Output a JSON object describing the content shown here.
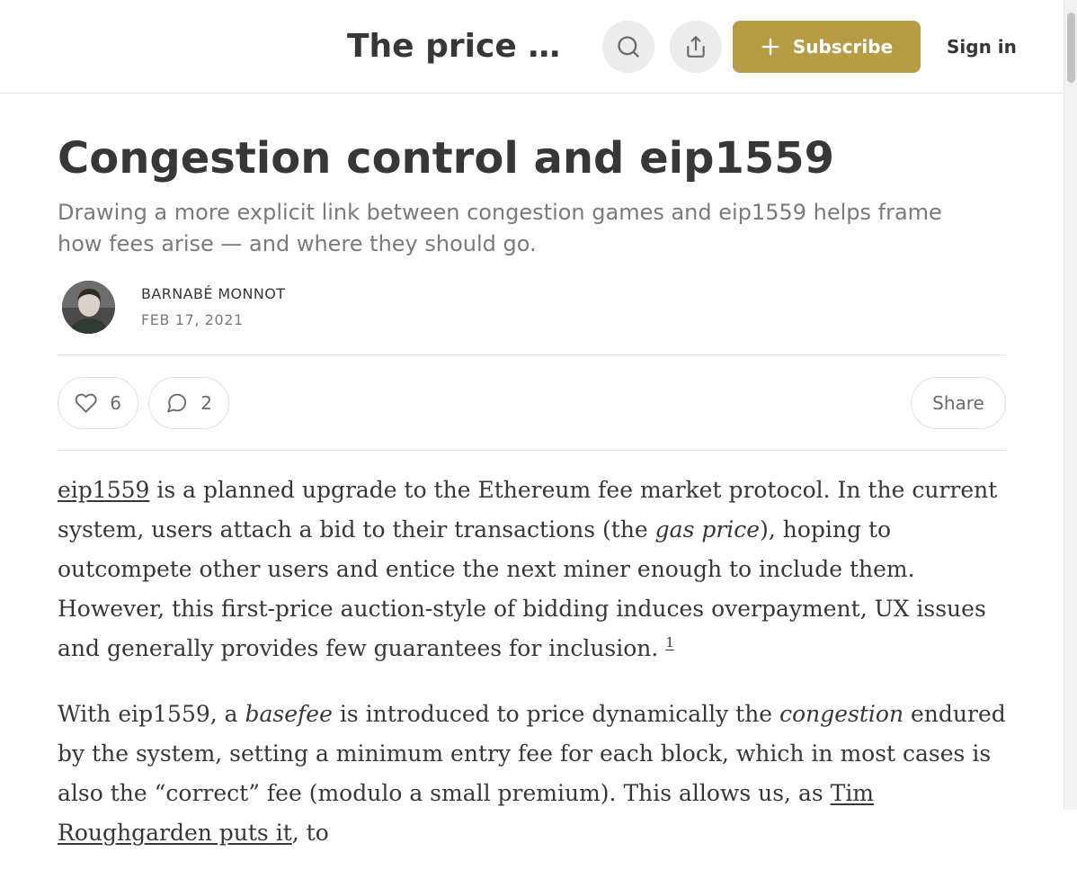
{
  "header": {
    "publication_title": "The price of agency",
    "search_icon": "search-icon",
    "share_icon": "share-icon",
    "subscribe_label": "Subscribe",
    "signin_label": "Sign in"
  },
  "post": {
    "title": "Congestion control and eip1559",
    "subtitle": "Drawing a more explicit link between congestion games and eip1559 helps frame how fees arise — and where they should go.",
    "author": "BARNABÉ MONNOT",
    "date": "FEB 17, 2021"
  },
  "actions": {
    "likes": "6",
    "comments": "2",
    "share_label": "Share"
  },
  "body": {
    "p1": {
      "link_eip": "eip1559",
      "t1": " is a planned upgrade to the Ethereum fee market protocol. In the current system, users attach a bid to their transactions (the ",
      "em_gas": "gas price",
      "t2": "), hoping to outcompete other users and entice the next miner enough to include them. However, this first-price auction-style of bidding induces overpayment, UX issues and generally provides few guarantees for inclusion. ",
      "footnote": "1"
    },
    "p2": {
      "t1": "With eip1559, a ",
      "em_basefee": "basefee",
      "t2": " is introduced to price dynamically the ",
      "em_congestion": "congestion",
      "t3": " endured by the system, setting a minimum entry fee for each block, which in most cases is also the “correct” fee (modulo a small premium). This allows us, as ",
      "link_tim": "Tim Roughgarden puts it",
      "t4": ", to"
    }
  },
  "colors": {
    "accent": "#b89c45",
    "text": "#363737",
    "muted": "#7a7a7a"
  }
}
